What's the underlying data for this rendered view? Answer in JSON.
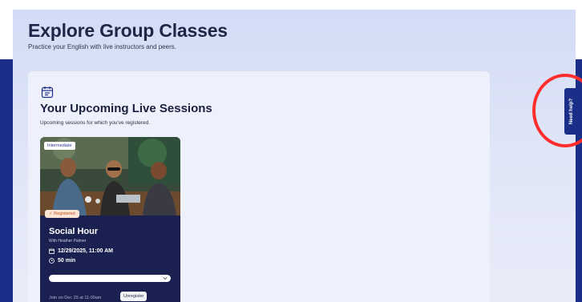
{
  "header": {
    "title": "Explore Group Classes",
    "subtitle": "Practice your English with live instructors and peers."
  },
  "upcoming": {
    "title": "Your Upcoming Live Sessions",
    "subtitle": "Upcoming sessions for which you've registered.",
    "icon": "calendar-icon"
  },
  "session": {
    "level": "Intermediate",
    "status": "✓ Registered",
    "title": "Social Hour",
    "instructor": "With Heather Palmer",
    "datetime": "12/29/2025, 11:00 AM",
    "duration": "50 min",
    "calendar_value": "",
    "join_text": "Join on Dec 29 at 11:00am",
    "unregister_label": "Unregister"
  },
  "help": {
    "label": "Need help?"
  },
  "colors": {
    "brand_navy": "#1c2f88",
    "card_background": "#1a2050",
    "highlight": "#ff2e2e",
    "registered_badge": "#c0521f"
  }
}
